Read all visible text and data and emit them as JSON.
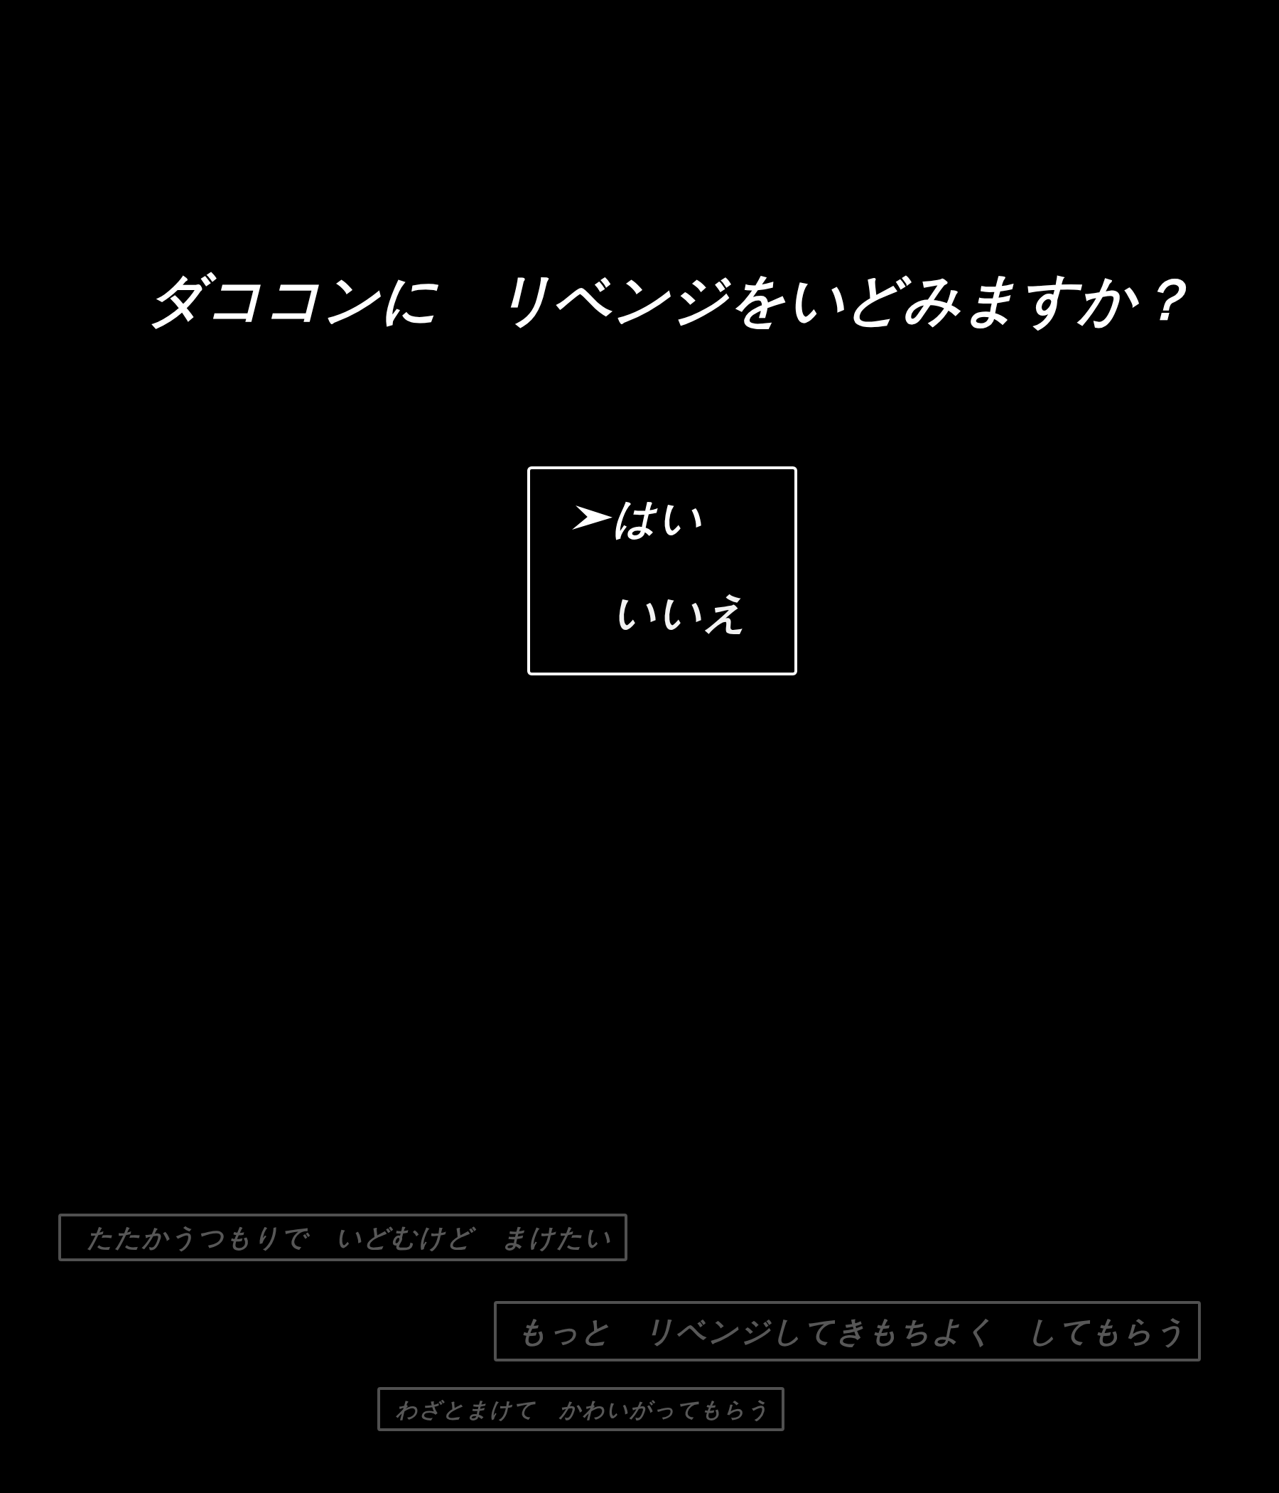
{
  "prompt": {
    "text": "ダココンに　リベンジをいどみますか？"
  },
  "choices": [
    {
      "label": "はい",
      "selected": true
    },
    {
      "label": "いいえ",
      "selected": false
    }
  ],
  "extra_choices": [
    {
      "label": "たたかうつもりで　いどむけど　まけたい",
      "disabled": true
    },
    {
      "label": "もっと　リベンジしてきもちよく　してもらう",
      "disabled": true
    },
    {
      "label": "わざとまけて　かわいがってもらう",
      "disabled": true
    }
  ]
}
